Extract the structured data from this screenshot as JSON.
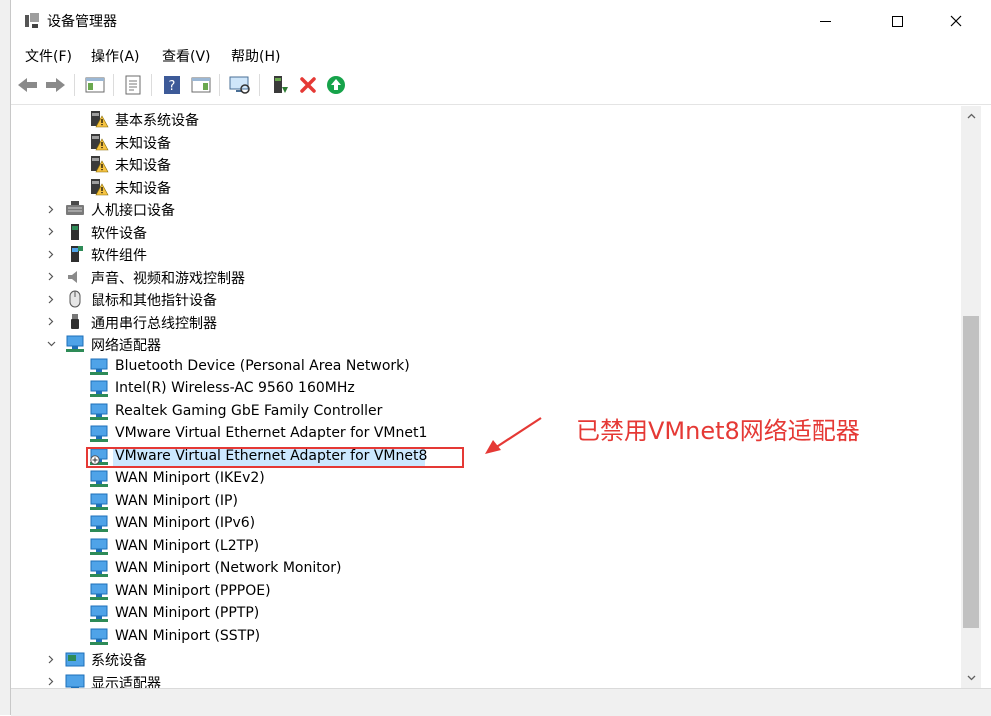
{
  "window": {
    "title": "设备管理器",
    "minimize_label": "—",
    "maximize_label": "☐",
    "close_label": "✕"
  },
  "menu": [
    {
      "label": "文件(F)"
    },
    {
      "label": "操作(A)"
    },
    {
      "label": "查看(V)"
    },
    {
      "label": "帮助(H)"
    }
  ],
  "toolbar": [
    {
      "name": "back-icon"
    },
    {
      "name": "forward-icon"
    },
    {
      "name": "show-hide-tree-icon"
    },
    {
      "name": "properties-icon"
    },
    {
      "name": "help-icon"
    },
    {
      "name": "action-pane-icon"
    },
    {
      "name": "scan-hardware-icon"
    },
    {
      "name": "update-driver-icon"
    },
    {
      "name": "uninstall-icon"
    },
    {
      "name": "enable-device-icon"
    }
  ],
  "tree": [
    {
      "label": "基本系统设备",
      "level": 1,
      "icon": "warning-device-icon"
    },
    {
      "label": "未知设备",
      "level": 1,
      "icon": "warning-device-icon"
    },
    {
      "label": "未知设备",
      "level": 1,
      "icon": "warning-device-icon"
    },
    {
      "label": "未知设备",
      "level": 1,
      "icon": "warning-device-icon"
    },
    {
      "label": "人机接口设备",
      "level": 0,
      "expander": "collapsed",
      "icon": "hid-icon"
    },
    {
      "label": "软件设备",
      "level": 0,
      "expander": "collapsed",
      "icon": "software-device-icon"
    },
    {
      "label": "软件组件",
      "level": 0,
      "expander": "collapsed",
      "icon": "software-component-icon"
    },
    {
      "label": "声音、视频和游戏控制器",
      "level": 0,
      "expander": "collapsed",
      "icon": "speaker-icon"
    },
    {
      "label": "鼠标和其他指针设备",
      "level": 0,
      "expander": "collapsed",
      "icon": "mouse-icon"
    },
    {
      "label": "通用串行总线控制器",
      "level": 0,
      "expander": "collapsed",
      "icon": "usb-icon"
    },
    {
      "label": "网络适配器",
      "level": 0,
      "expander": "expanded",
      "icon": "network-adapter-icon"
    },
    {
      "label": "Bluetooth Device (Personal Area Network)",
      "level": 1,
      "icon": "network-adapter-icon"
    },
    {
      "label": "Intel(R) Wireless-AC 9560 160MHz",
      "level": 1,
      "icon": "network-adapter-icon"
    },
    {
      "label": "Realtek Gaming GbE Family Controller",
      "level": 1,
      "icon": "network-adapter-icon"
    },
    {
      "label": "VMware Virtual Ethernet Adapter for VMnet1",
      "level": 1,
      "icon": "network-adapter-icon"
    },
    {
      "label": "VMware Virtual Ethernet Adapter for VMnet8",
      "level": 1,
      "icon": "disabled-network-adapter-icon",
      "selected": true
    },
    {
      "label": "WAN Miniport (IKEv2)",
      "level": 1,
      "icon": "network-adapter-icon"
    },
    {
      "label": "WAN Miniport (IP)",
      "level": 1,
      "icon": "network-adapter-icon"
    },
    {
      "label": "WAN Miniport (IPv6)",
      "level": 1,
      "icon": "network-adapter-icon"
    },
    {
      "label": "WAN Miniport (L2TP)",
      "level": 1,
      "icon": "network-adapter-icon"
    },
    {
      "label": "WAN Miniport (Network Monitor)",
      "level": 1,
      "icon": "network-adapter-icon"
    },
    {
      "label": "WAN Miniport (PPPOE)",
      "level": 1,
      "icon": "network-adapter-icon"
    },
    {
      "label": "WAN Miniport (PPTP)",
      "level": 1,
      "icon": "network-adapter-icon"
    },
    {
      "label": "WAN Miniport (SSTP)",
      "level": 1,
      "icon": "network-adapter-icon"
    },
    {
      "label": "系统设备",
      "level": 0,
      "expander": "collapsed",
      "icon": "system-device-icon"
    },
    {
      "label": "显示适配器",
      "level": 0,
      "expander": "collapsed",
      "icon": "display-adapter-icon"
    }
  ],
  "annotation": {
    "text": "已禁用VMnet8网络适配器",
    "color": "#e53935"
  },
  "colors": {
    "selection": "#cce8ff",
    "annotation_red": "#e53935",
    "network_blue": "#1e88e5"
  }
}
